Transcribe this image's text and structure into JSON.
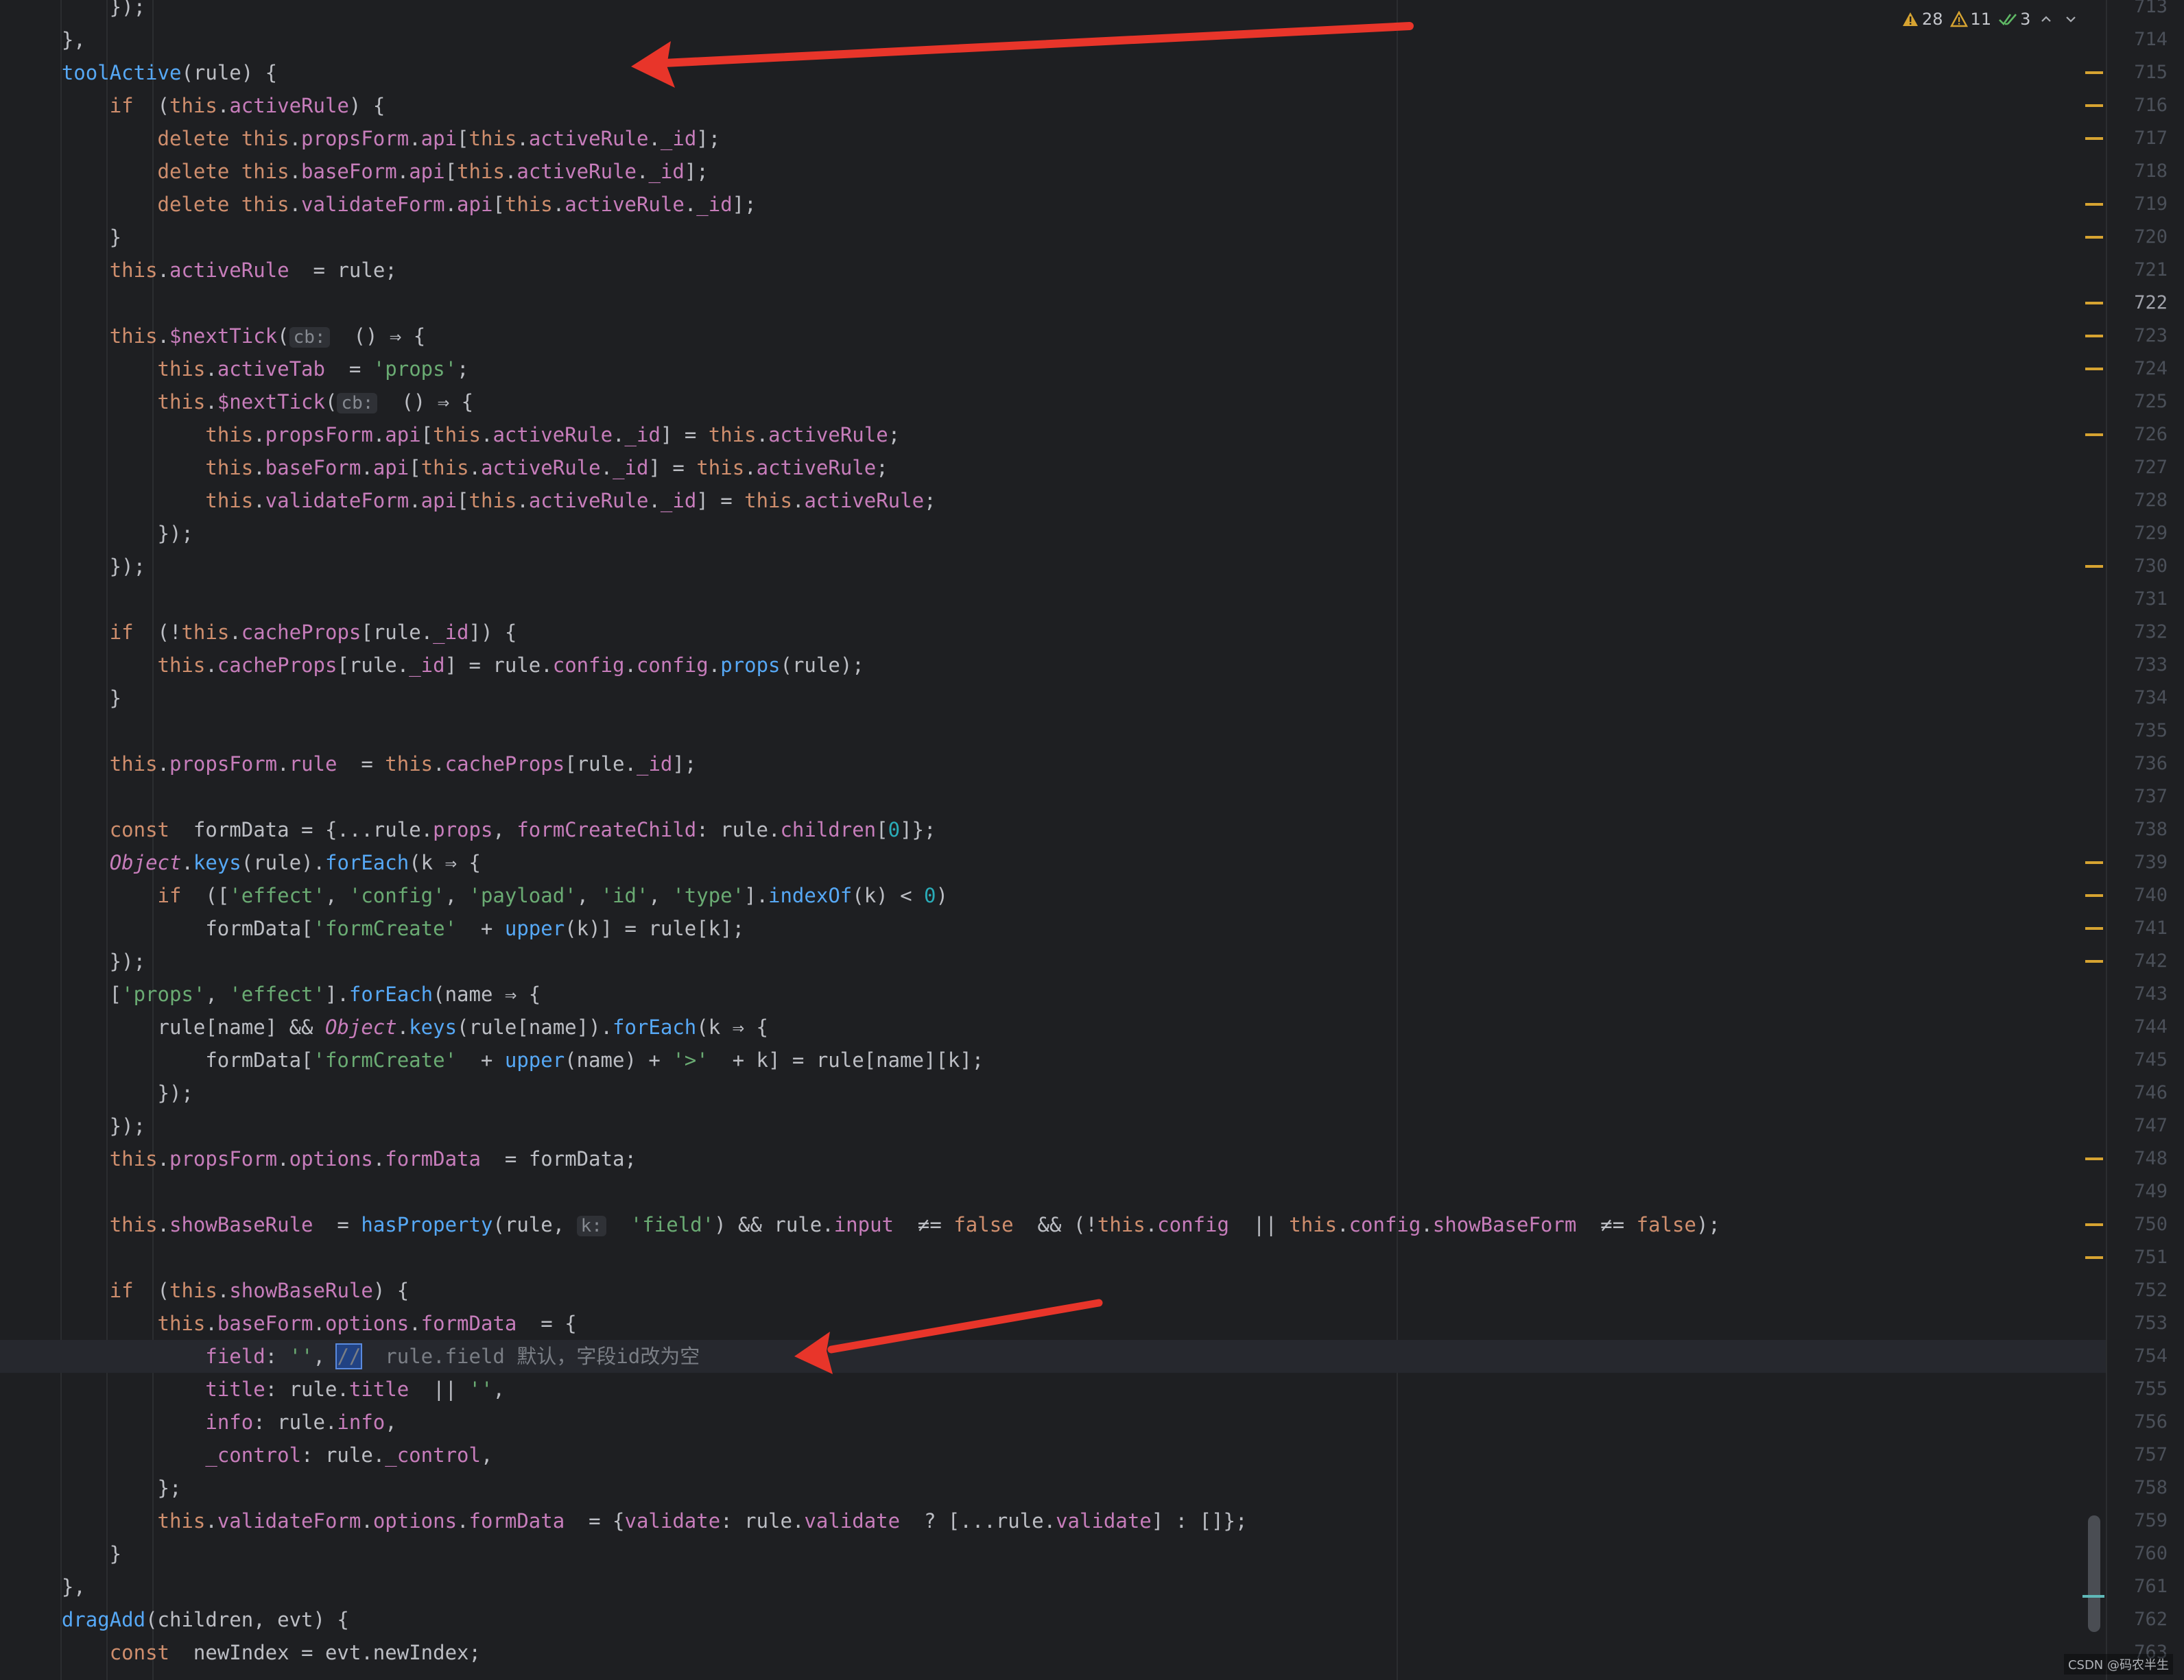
{
  "editor": {
    "first_line_number": 713,
    "active_line_number": 722,
    "highlighted_line_number": 754,
    "line_numbers": [
      "713",
      "714",
      "715",
      "716",
      "717",
      "718",
      "719",
      "720",
      "721",
      "722",
      "723",
      "724",
      "725",
      "726",
      "727",
      "728",
      "729",
      "730",
      "731",
      "732",
      "733",
      "734",
      "735",
      "736",
      "737",
      "738",
      "739",
      "740",
      "741",
      "742",
      "743",
      "744",
      "745",
      "746",
      "747",
      "748",
      "749",
      "750",
      "751",
      "752",
      "753",
      "754",
      "755",
      "756",
      "757",
      "758",
      "759",
      "760",
      "761",
      "762",
      "763"
    ]
  },
  "inspections": {
    "warnings_count": "28",
    "weak_warnings_count": "11",
    "ok_count": "3",
    "warning_icon": "warning-triangle-icon",
    "weak_warning_icon": "weak-warning-triangle-icon",
    "ok_icon": "double-check-icon",
    "prev_icon": "chevron-up-icon",
    "next_icon": "chevron-down-icon"
  },
  "code_lines": [
    [
      [
        "    });",
        "plain"
      ]
    ],
    [
      [
        "  },",
        "plain"
      ]
    ],
    [
      [
        "  ",
        "plain"
      ],
      [
        "toolActive",
        "fn"
      ],
      [
        "(rule) {",
        "plain"
      ]
    ],
    [
      [
        "    ",
        "plain"
      ],
      [
        "if",
        "kw"
      ],
      [
        " (",
        "plain"
      ],
      [
        "this",
        "this"
      ],
      [
        ".",
        "plain"
      ],
      [
        "activeRule",
        "prop"
      ],
      [
        ") {",
        "plain"
      ]
    ],
    [
      [
        "      ",
        "plain"
      ],
      [
        "delete ",
        "kw"
      ],
      [
        "this",
        "this"
      ],
      [
        ".",
        "plain"
      ],
      [
        "propsForm",
        "prop"
      ],
      [
        ".",
        "plain"
      ],
      [
        "api",
        "prop"
      ],
      [
        "[",
        "plain"
      ],
      [
        "this",
        "this"
      ],
      [
        ".",
        "plain"
      ],
      [
        "activeRule",
        "prop"
      ],
      [
        ".",
        "plain"
      ],
      [
        "_id",
        "prop"
      ],
      [
        "];",
        "plain"
      ]
    ],
    [
      [
        "      ",
        "plain"
      ],
      [
        "delete ",
        "kw"
      ],
      [
        "this",
        "this"
      ],
      [
        ".",
        "plain"
      ],
      [
        "baseForm",
        "prop"
      ],
      [
        ".",
        "plain"
      ],
      [
        "api",
        "prop"
      ],
      [
        "[",
        "plain"
      ],
      [
        "this",
        "this"
      ],
      [
        ".",
        "plain"
      ],
      [
        "activeRule",
        "prop"
      ],
      [
        ".",
        "plain"
      ],
      [
        "_id",
        "prop"
      ],
      [
        "];",
        "plain"
      ]
    ],
    [
      [
        "      ",
        "plain"
      ],
      [
        "delete ",
        "kw"
      ],
      [
        "this",
        "this"
      ],
      [
        ".",
        "plain"
      ],
      [
        "validateForm",
        "prop"
      ],
      [
        ".",
        "plain"
      ],
      [
        "api",
        "prop"
      ],
      [
        "[",
        "plain"
      ],
      [
        "this",
        "this"
      ],
      [
        ".",
        "plain"
      ],
      [
        "activeRule",
        "prop"
      ],
      [
        ".",
        "plain"
      ],
      [
        "_id",
        "prop"
      ],
      [
        "];",
        "plain"
      ]
    ],
    [
      [
        "    }",
        "plain"
      ]
    ],
    [
      [
        "    ",
        "plain"
      ],
      [
        "this",
        "this"
      ],
      [
        ".",
        "plain"
      ],
      [
        "activeRule",
        "prop"
      ],
      [
        " = rule;",
        "plain"
      ]
    ],
    [
      [
        "",
        "plain"
      ]
    ],
    [
      [
        "    ",
        "plain"
      ],
      [
        "this",
        "this"
      ],
      [
        ".",
        "plain"
      ],
      [
        "$nextTick",
        "prop"
      ],
      [
        "(",
        "plain"
      ],
      [
        "cb:",
        "hint"
      ],
      [
        " () ⇒ {",
        "plain"
      ]
    ],
    [
      [
        "      ",
        "plain"
      ],
      [
        "this",
        "this"
      ],
      [
        ".",
        "plain"
      ],
      [
        "activeTab",
        "prop"
      ],
      [
        " = ",
        "plain"
      ],
      [
        "'props'",
        "str"
      ],
      [
        ";",
        "plain"
      ]
    ],
    [
      [
        "      ",
        "plain"
      ],
      [
        "this",
        "this"
      ],
      [
        ".",
        "plain"
      ],
      [
        "$nextTick",
        "prop"
      ],
      [
        "(",
        "plain"
      ],
      [
        "cb:",
        "hint"
      ],
      [
        " () ⇒ {",
        "plain"
      ]
    ],
    [
      [
        "        ",
        "plain"
      ],
      [
        "this",
        "this"
      ],
      [
        ".",
        "plain"
      ],
      [
        "propsForm",
        "prop"
      ],
      [
        ".",
        "plain"
      ],
      [
        "api",
        "prop"
      ],
      [
        "[",
        "plain"
      ],
      [
        "this",
        "this"
      ],
      [
        ".",
        "plain"
      ],
      [
        "activeRule",
        "prop"
      ],
      [
        ".",
        "plain"
      ],
      [
        "_id",
        "prop"
      ],
      [
        "] = ",
        "plain"
      ],
      [
        "this",
        "this"
      ],
      [
        ".",
        "plain"
      ],
      [
        "activeRule",
        "prop"
      ],
      [
        ";",
        "plain"
      ]
    ],
    [
      [
        "        ",
        "plain"
      ],
      [
        "this",
        "this"
      ],
      [
        ".",
        "plain"
      ],
      [
        "baseForm",
        "prop"
      ],
      [
        ".",
        "plain"
      ],
      [
        "api",
        "prop"
      ],
      [
        "[",
        "plain"
      ],
      [
        "this",
        "this"
      ],
      [
        ".",
        "plain"
      ],
      [
        "activeRule",
        "prop"
      ],
      [
        ".",
        "plain"
      ],
      [
        "_id",
        "prop"
      ],
      [
        "] = ",
        "plain"
      ],
      [
        "this",
        "this"
      ],
      [
        ".",
        "plain"
      ],
      [
        "activeRule",
        "prop"
      ],
      [
        ";",
        "plain"
      ]
    ],
    [
      [
        "        ",
        "plain"
      ],
      [
        "this",
        "this"
      ],
      [
        ".",
        "plain"
      ],
      [
        "validateForm",
        "prop"
      ],
      [
        ".",
        "plain"
      ],
      [
        "api",
        "prop"
      ],
      [
        "[",
        "plain"
      ],
      [
        "this",
        "this"
      ],
      [
        ".",
        "plain"
      ],
      [
        "activeRule",
        "prop"
      ],
      [
        ".",
        "plain"
      ],
      [
        "_id",
        "prop"
      ],
      [
        "] = ",
        "plain"
      ],
      [
        "this",
        "this"
      ],
      [
        ".",
        "plain"
      ],
      [
        "activeRule",
        "prop"
      ],
      [
        ";",
        "plain"
      ]
    ],
    [
      [
        "      });",
        "plain"
      ]
    ],
    [
      [
        "    });",
        "plain"
      ]
    ],
    [
      [
        "",
        "plain"
      ]
    ],
    [
      [
        "    ",
        "plain"
      ],
      [
        "if",
        "kw"
      ],
      [
        " (!",
        "plain"
      ],
      [
        "this",
        "this"
      ],
      [
        ".",
        "plain"
      ],
      [
        "cacheProps",
        "prop"
      ],
      [
        "[rule.",
        "plain"
      ],
      [
        "_id",
        "prop"
      ],
      [
        "]) {",
        "plain"
      ]
    ],
    [
      [
        "      ",
        "plain"
      ],
      [
        "this",
        "this"
      ],
      [
        ".",
        "plain"
      ],
      [
        "cacheProps",
        "prop"
      ],
      [
        "[rule.",
        "plain"
      ],
      [
        "_id",
        "prop"
      ],
      [
        "] = rule.",
        "plain"
      ],
      [
        "config",
        "prop"
      ],
      [
        ".",
        "plain"
      ],
      [
        "config",
        "prop"
      ],
      [
        ".",
        "plain"
      ],
      [
        "props",
        "fn"
      ],
      [
        "(rule);",
        "plain"
      ]
    ],
    [
      [
        "    }",
        "plain"
      ]
    ],
    [
      [
        "",
        "plain"
      ]
    ],
    [
      [
        "    ",
        "plain"
      ],
      [
        "this",
        "this"
      ],
      [
        ".",
        "plain"
      ],
      [
        "propsForm",
        "prop"
      ],
      [
        ".",
        "plain"
      ],
      [
        "rule",
        "prop"
      ],
      [
        " = ",
        "plain"
      ],
      [
        "this",
        "this"
      ],
      [
        ".",
        "plain"
      ],
      [
        "cacheProps",
        "prop"
      ],
      [
        "[rule.",
        "plain"
      ],
      [
        "_id",
        "prop"
      ],
      [
        "];",
        "plain"
      ]
    ],
    [
      [
        "",
        "plain"
      ]
    ],
    [
      [
        "    ",
        "plain"
      ],
      [
        "const",
        "kw"
      ],
      [
        " formData = {...rule.",
        "plain"
      ],
      [
        "props",
        "prop"
      ],
      [
        ", ",
        "plain"
      ],
      [
        "formCreateChild",
        "prop"
      ],
      [
        ": rule.",
        "plain"
      ],
      [
        "children",
        "prop"
      ],
      [
        "[",
        "plain"
      ],
      [
        "0",
        "num"
      ],
      [
        "]};",
        "plain"
      ]
    ],
    [
      [
        "    ",
        "plain"
      ],
      [
        "Object",
        "obj"
      ],
      [
        ".",
        "plain"
      ],
      [
        "keys",
        "fn"
      ],
      [
        "(rule).",
        "plain"
      ],
      [
        "forEach",
        "fn"
      ],
      [
        "(k ⇒ {",
        "plain"
      ]
    ],
    [
      [
        "      ",
        "plain"
      ],
      [
        "if",
        "kw"
      ],
      [
        " ([",
        "plain"
      ],
      [
        "'effect'",
        "str"
      ],
      [
        ", ",
        "plain"
      ],
      [
        "'config'",
        "str"
      ],
      [
        ", ",
        "plain"
      ],
      [
        "'payload'",
        "str"
      ],
      [
        ", ",
        "plain"
      ],
      [
        "'id'",
        "str"
      ],
      [
        ", ",
        "plain"
      ],
      [
        "'type'",
        "str"
      ],
      [
        "].",
        "plain"
      ],
      [
        "indexOf",
        "fn"
      ],
      [
        "(k) < ",
        "plain"
      ],
      [
        "0",
        "num"
      ],
      [
        ")",
        "plain"
      ]
    ],
    [
      [
        "        formData[",
        "plain"
      ],
      [
        "'formCreate'",
        "str"
      ],
      [
        " + ",
        "plain"
      ],
      [
        "upper",
        "fn"
      ],
      [
        "(k)] = rule[k];",
        "plain"
      ]
    ],
    [
      [
        "    });",
        "plain"
      ]
    ],
    [
      [
        "    [",
        "plain"
      ],
      [
        "'props'",
        "str"
      ],
      [
        ", ",
        "plain"
      ],
      [
        "'effect'",
        "str"
      ],
      [
        "].",
        "plain"
      ],
      [
        "forEach",
        "fn"
      ],
      [
        "(name ⇒ {",
        "plain"
      ]
    ],
    [
      [
        "      rule[name] && ",
        "plain"
      ],
      [
        "Object",
        "obj"
      ],
      [
        ".",
        "plain"
      ],
      [
        "keys",
        "fn"
      ],
      [
        "(rule[name]).",
        "plain"
      ],
      [
        "forEach",
        "fn"
      ],
      [
        "(k ⇒ {",
        "plain"
      ]
    ],
    [
      [
        "        formData[",
        "plain"
      ],
      [
        "'formCreate'",
        "str"
      ],
      [
        " + ",
        "plain"
      ],
      [
        "upper",
        "fn"
      ],
      [
        "(name) + ",
        "plain"
      ],
      [
        "'>'",
        "str"
      ],
      [
        " + k] = rule[name][k];",
        "plain"
      ]
    ],
    [
      [
        "      });",
        "plain"
      ]
    ],
    [
      [
        "    });",
        "plain"
      ]
    ],
    [
      [
        "    ",
        "plain"
      ],
      [
        "this",
        "this"
      ],
      [
        ".",
        "plain"
      ],
      [
        "propsForm",
        "prop"
      ],
      [
        ".",
        "plain"
      ],
      [
        "options",
        "prop"
      ],
      [
        ".",
        "plain"
      ],
      [
        "formData",
        "prop"
      ],
      [
        " = formData;",
        "plain"
      ]
    ],
    [
      [
        "",
        "plain"
      ]
    ],
    [
      [
        "    ",
        "plain"
      ],
      [
        "this",
        "this"
      ],
      [
        ".",
        "plain"
      ],
      [
        "showBaseRule",
        "prop"
      ],
      [
        " = ",
        "plain"
      ],
      [
        "hasProperty",
        "fn"
      ],
      [
        "(rule, ",
        "plain"
      ],
      [
        "k:",
        "hint"
      ],
      [
        " ",
        "plain"
      ],
      [
        "'field'",
        "str"
      ],
      [
        ") && rule.",
        "plain"
      ],
      [
        "input",
        "prop"
      ],
      [
        " ≠= ",
        "plain"
      ],
      [
        "false",
        "kw"
      ],
      [
        " && (!",
        "plain"
      ],
      [
        "this",
        "this"
      ],
      [
        ".",
        "plain"
      ],
      [
        "config",
        "prop"
      ],
      [
        " || ",
        "plain"
      ],
      [
        "this",
        "this"
      ],
      [
        ".",
        "plain"
      ],
      [
        "config",
        "prop"
      ],
      [
        ".",
        "plain"
      ],
      [
        "showBaseForm",
        "prop"
      ],
      [
        " ≠= ",
        "plain"
      ],
      [
        "false",
        "kw"
      ],
      [
        ");",
        "plain"
      ]
    ],
    [
      [
        "",
        "plain"
      ]
    ],
    [
      [
        "    ",
        "plain"
      ],
      [
        "if",
        "kw"
      ],
      [
        " (",
        "plain"
      ],
      [
        "this",
        "this"
      ],
      [
        ".",
        "plain"
      ],
      [
        "showBaseRule",
        "prop"
      ],
      [
        ") {",
        "plain"
      ]
    ],
    [
      [
        "      ",
        "plain"
      ],
      [
        "this",
        "this"
      ],
      [
        ".",
        "plain"
      ],
      [
        "baseForm",
        "prop"
      ],
      [
        ".",
        "plain"
      ],
      [
        "options",
        "prop"
      ],
      [
        ".",
        "plain"
      ],
      [
        "formData",
        "prop"
      ],
      [
        " = {",
        "plain"
      ]
    ],
    [
      [
        "        ",
        "plain"
      ],
      [
        "field",
        "prop"
      ],
      [
        ": ",
        "plain"
      ],
      [
        "''",
        "str"
      ],
      [
        ", ",
        "plain"
      ],
      [
        "//",
        "sel"
      ],
      [
        " rule.field 默认，字段id改为空",
        "comment"
      ]
    ],
    [
      [
        "        ",
        "plain"
      ],
      [
        "title",
        "prop"
      ],
      [
        ": rule.",
        "plain"
      ],
      [
        "title",
        "prop"
      ],
      [
        " || ",
        "plain"
      ],
      [
        "''",
        "str"
      ],
      [
        ",",
        "plain"
      ]
    ],
    [
      [
        "        ",
        "plain"
      ],
      [
        "info",
        "prop"
      ],
      [
        ": rule.",
        "plain"
      ],
      [
        "info",
        "prop"
      ],
      [
        ",",
        "plain"
      ]
    ],
    [
      [
        "        ",
        "plain"
      ],
      [
        "_control",
        "prop"
      ],
      [
        ": rule.",
        "plain"
      ],
      [
        "_control",
        "prop"
      ],
      [
        ",",
        "plain"
      ]
    ],
    [
      [
        "      };",
        "plain"
      ]
    ],
    [
      [
        "      ",
        "plain"
      ],
      [
        "this",
        "this"
      ],
      [
        ".",
        "plain"
      ],
      [
        "validateForm",
        "prop"
      ],
      [
        ".",
        "plain"
      ],
      [
        "options",
        "prop"
      ],
      [
        ".",
        "plain"
      ],
      [
        "formData",
        "prop"
      ],
      [
        " = {",
        "plain"
      ],
      [
        "validate",
        "prop"
      ],
      [
        ": rule.",
        "plain"
      ],
      [
        "validate",
        "prop"
      ],
      [
        " ? [...rule.",
        "plain"
      ],
      [
        "validate",
        "prop"
      ],
      [
        "] : []};",
        "plain"
      ]
    ],
    [
      [
        "    }",
        "plain"
      ]
    ],
    [
      [
        "  },",
        "plain"
      ]
    ],
    [
      [
        "  ",
        "plain"
      ],
      [
        "dragAdd",
        "fn"
      ],
      [
        "(children, evt) {",
        "plain"
      ]
    ],
    [
      [
        "    ",
        "plain"
      ],
      [
        "const",
        "kw"
      ],
      [
        " newIndex = evt.newIndex;",
        "plain"
      ]
    ]
  ],
  "stripe_marks": [
    "715",
    "716",
    "717",
    "719",
    "720",
    "722",
    "723",
    "724",
    "726",
    "730",
    "739",
    "740",
    "741",
    "742",
    "748",
    "750",
    "751"
  ],
  "watermark": "CSDN @码农半生",
  "colors": {
    "background": "#1e1f22",
    "keyword": "#cf8e6d",
    "property": "#c77dbb",
    "function": "#56a8f5",
    "string": "#6aab73",
    "number": "#2aacb8",
    "comment": "#7a7e85",
    "annotation_arrow": "#e8352a",
    "warning": "#d6a331"
  }
}
